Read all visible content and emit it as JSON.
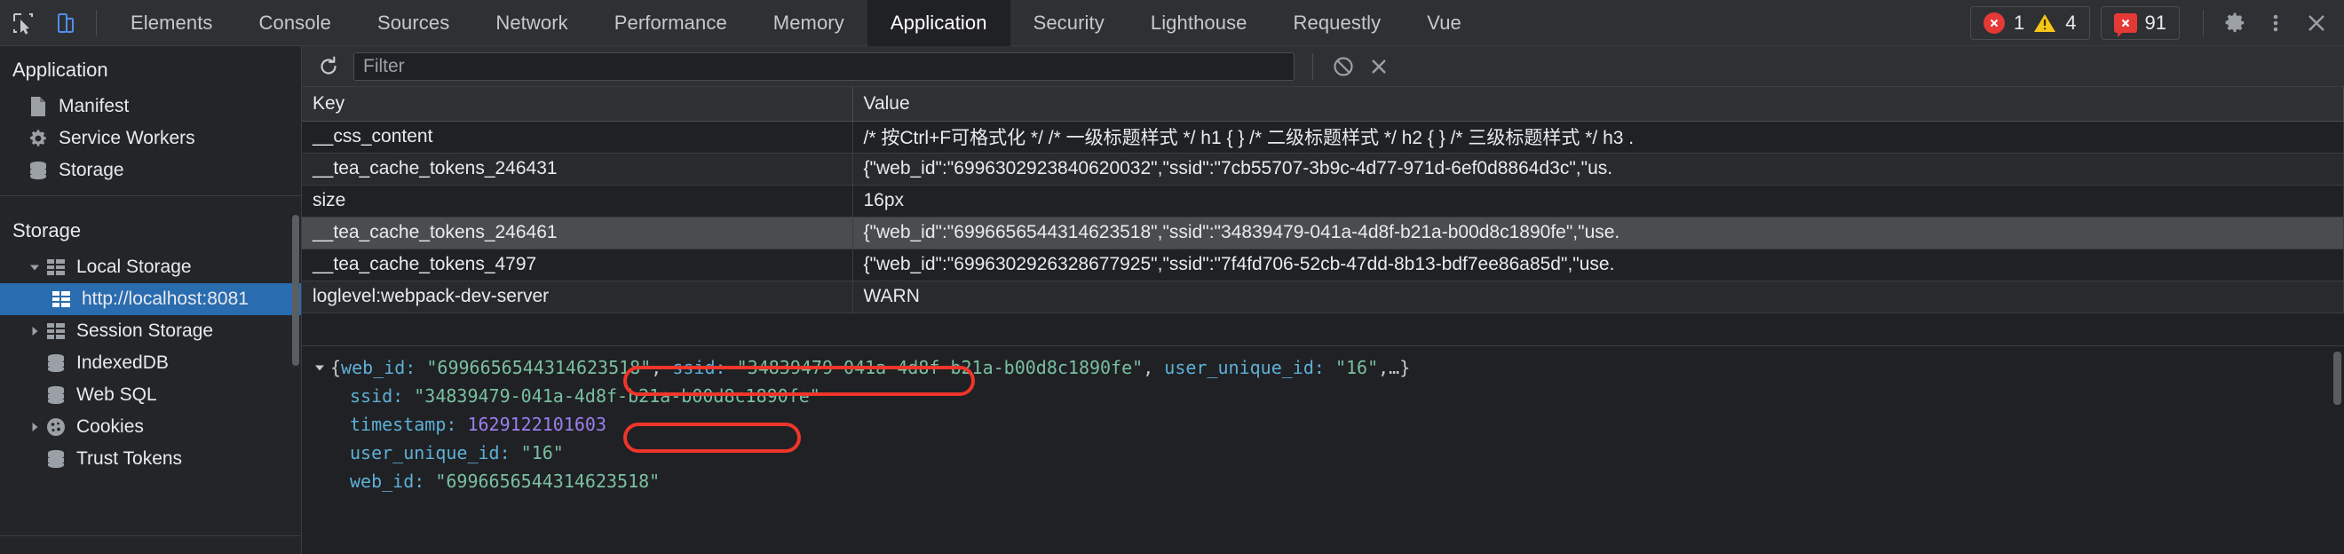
{
  "toolbar": {
    "inspect_icon": "inspect-element-icon",
    "device_icon": "device-toolbar-icon",
    "tabs": [
      {
        "label": "Elements",
        "active": false
      },
      {
        "label": "Console",
        "active": false
      },
      {
        "label": "Sources",
        "active": false
      },
      {
        "label": "Network",
        "active": false
      },
      {
        "label": "Performance",
        "active": false
      },
      {
        "label": "Memory",
        "active": false
      },
      {
        "label": "Application",
        "active": true
      },
      {
        "label": "Security",
        "active": false
      },
      {
        "label": "Lighthouse",
        "active": false
      },
      {
        "label": "Requestly",
        "active": false
      },
      {
        "label": "Vue",
        "active": false
      }
    ],
    "error_count": "1",
    "warning_count": "4",
    "message_count": "91",
    "settings_icon": "gear-icon",
    "more_icon": "more-vertical-icon",
    "close_icon": "close-icon"
  },
  "sidebar": {
    "application_title": "Application",
    "application_items": [
      {
        "label": "Manifest",
        "icon": "manifest-file-icon"
      },
      {
        "label": "Service Workers",
        "icon": "gear-icon"
      },
      {
        "label": "Storage",
        "icon": "database-icon"
      }
    ],
    "storage_title": "Storage",
    "storage_items": [
      {
        "label": "Local Storage",
        "icon": "table-grid-icon",
        "expanded": true,
        "indent": 1,
        "selected": false
      },
      {
        "label": "http://localhost:8081",
        "icon": "table-grid-icon",
        "expanded": false,
        "indent": 2,
        "selected": true
      },
      {
        "label": "Session Storage",
        "icon": "table-grid-icon",
        "expanded": false,
        "indent": 1,
        "selected": false
      },
      {
        "label": "IndexedDB",
        "icon": "database-icon",
        "expanded": null,
        "indent": 1,
        "selected": false
      },
      {
        "label": "Web SQL",
        "icon": "database-icon",
        "expanded": null,
        "indent": 1,
        "selected": false
      },
      {
        "label": "Cookies",
        "icon": "cookie-icon",
        "expanded": false,
        "indent": 1,
        "selected": false
      },
      {
        "label": "Trust Tokens",
        "icon": "database-icon",
        "expanded": null,
        "indent": 1,
        "selected": false
      }
    ]
  },
  "filterbar": {
    "refresh_icon": "refresh-icon",
    "filter_placeholder": "Filter",
    "filter_value": "",
    "clear_all_icon": "block-clear-icon",
    "delete_icon": "close-icon"
  },
  "table": {
    "columns": [
      "Key",
      "Value"
    ],
    "rows": [
      {
        "key": "__css_content",
        "value": "/* 按Ctrl+F可格式化 */ /* 一级标题样式 */ h1 { } /* 二级标题样式 */ h2 { } /* 三级标题样式 */ h3 .",
        "selected": false
      },
      {
        "key": "__tea_cache_tokens_246431",
        "value": "{\"web_id\":\"6996302923840620032\",\"ssid\":\"7cb55707-3b9c-4d77-971d-6ef0d8864d3c\",\"us.",
        "selected": false
      },
      {
        "key": "size",
        "value": "16px",
        "selected": false
      },
      {
        "key": "__tea_cache_tokens_246461",
        "value": "{\"web_id\":\"6996656544314623518\",\"ssid\":\"34839479-041a-4d8f-b21a-b00d8c1890fe\",\"use.",
        "selected": true
      },
      {
        "key": "__tea_cache_tokens_4797",
        "value": "{\"web_id\":\"6996302926328677925\",\"ssid\":\"7f4fd706-52cb-47dd-8b13-bdf7ee86a85d\",\"use.",
        "selected": false
      },
      {
        "key": "loglevel:webpack-dev-server",
        "value": "WARN",
        "selected": false
      }
    ]
  },
  "preview": {
    "summary": {
      "open_brace": "{",
      "web_id_key": "web_id:",
      "web_id_value": "\"6996656544314623518\"",
      "comma1": ",",
      "ssid_key": "ssid:",
      "ssid_value": "\"34839479-041a-4d8f-b21a-b00d8c1890fe\"",
      "comma2": ",",
      "uuid_key": "user_unique_id:",
      "uuid_value": "\"16\"",
      "ellipsis": ",…}"
    },
    "properties": [
      {
        "key": "ssid:",
        "value": "\"34839479-041a-4d8f-b21a-b00d8c1890fe\"",
        "type": "string",
        "highlighted": true
      },
      {
        "key": "timestamp:",
        "value": "1629122101603",
        "type": "number",
        "highlighted": false
      },
      {
        "key": "user_unique_id:",
        "value": "\"16\"",
        "type": "string",
        "highlighted": true
      },
      {
        "key": "web_id:",
        "value": "\"6996656544314623518\"",
        "type": "string",
        "highlighted": false
      }
    ],
    "highlight_color": "#f0352a"
  }
}
